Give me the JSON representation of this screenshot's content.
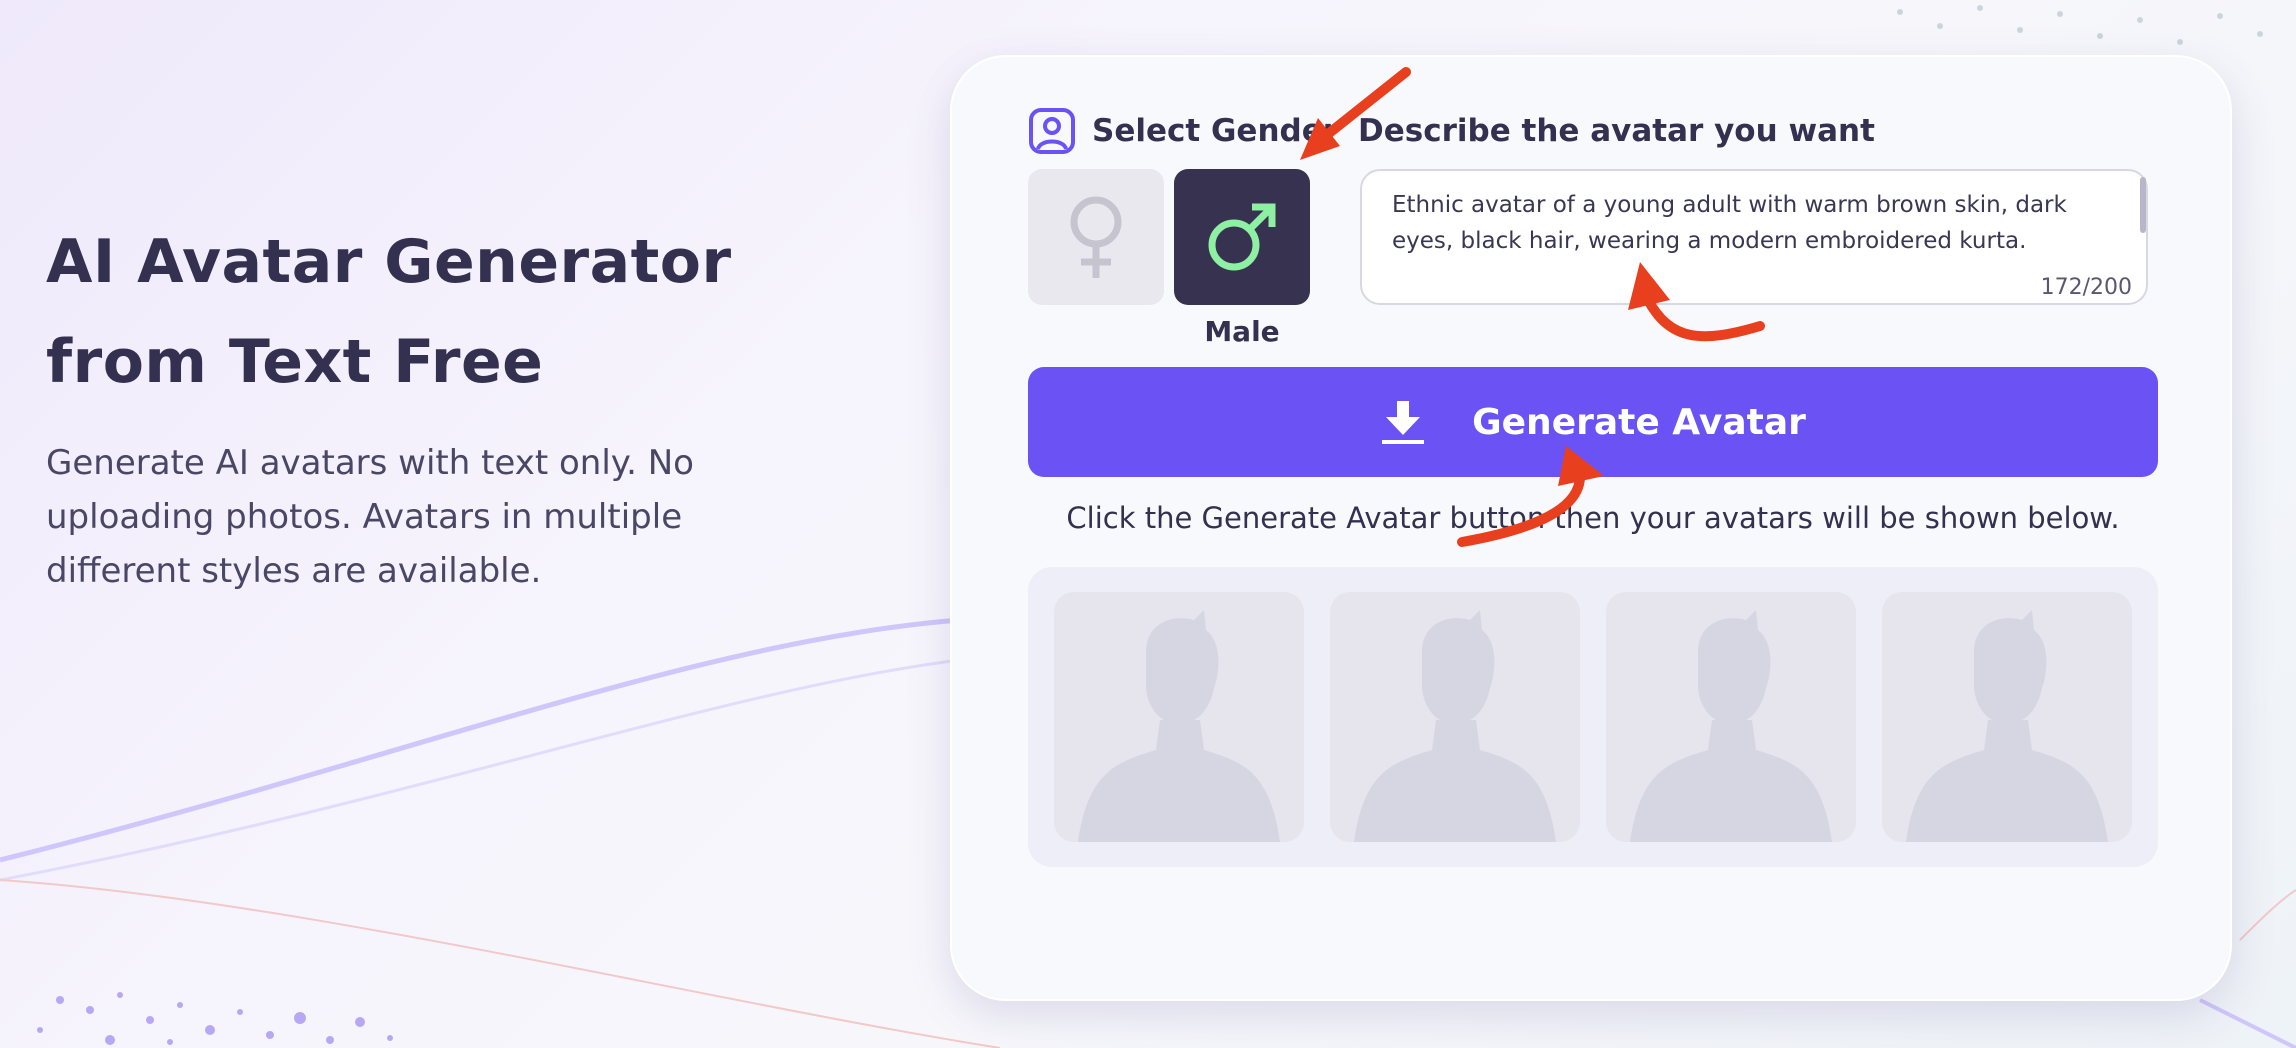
{
  "hero": {
    "title_line1": "AI Avatar Generator",
    "title_line2": "from Text Free",
    "description": "Generate AI avatars with text only. No uploading photos. Avatars in multiple different styles are available."
  },
  "card": {
    "gender_section": {
      "label": "Select Gender",
      "icon": "user-square-icon",
      "options": [
        {
          "icon": "female-symbol-icon",
          "selected": false
        },
        {
          "icon": "male-symbol-icon",
          "selected": true
        }
      ],
      "selected_caption": "Male"
    },
    "describe_section": {
      "label": "Describe the avatar you want",
      "value": "Ethnic avatar of a young adult with warm brown skin, dark eyes, black hair, wearing a modern embroidered kurta.",
      "char_count": "172/200"
    },
    "generate_button": {
      "label": "Generate Avatar",
      "icon": "download-icon"
    },
    "hint": "Click the Generate Avatar button then your avatars will be shown below.",
    "avatar_placeholders": [
      {
        "icon": "avatar-placeholder-icon"
      },
      {
        "icon": "avatar-placeholder-icon"
      },
      {
        "icon": "avatar-placeholder-icon"
      },
      {
        "icon": "avatar-placeholder-icon"
      }
    ]
  },
  "colors": {
    "accent": "#6b52f4",
    "dark_tile": "#37324f",
    "male_symbol": "#8ef0a2",
    "annotation_arrow": "#e8401e",
    "text_primary": "#34304f"
  }
}
